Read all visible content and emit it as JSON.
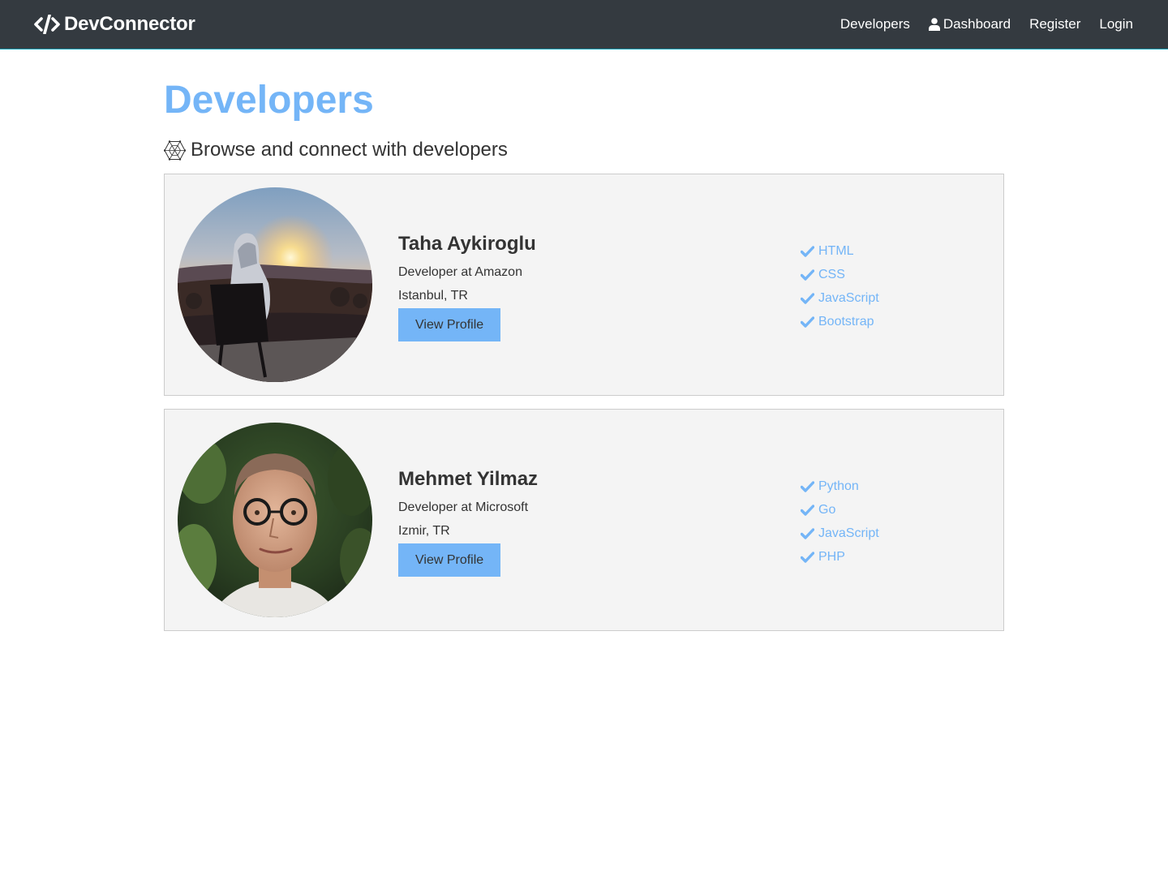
{
  "navbar": {
    "brand": "DevConnector",
    "links": [
      {
        "label": "Developers"
      },
      {
        "label": "Dashboard",
        "icon": "user-icon"
      },
      {
        "label": "Register"
      },
      {
        "label": "Login"
      }
    ]
  },
  "main": {
    "title": "Developers",
    "lead": "Browse and connect with developers",
    "lead_icon": "connectdevelop-icon"
  },
  "profiles": [
    {
      "name": "Taha Aykiroglu",
      "status": "Developer at Amazon",
      "location": "Istanbul, TR",
      "button": "View Profile",
      "avatar": "sunset-photo",
      "skills": [
        "HTML",
        "CSS",
        "JavaScript",
        "Bootstrap"
      ]
    },
    {
      "name": "Mehmet Yilmaz",
      "status": "Developer at Microsoft",
      "location": "Izmir, TR",
      "button": "View Profile",
      "avatar": "portrait-photo",
      "skills": [
        "Python",
        "Go",
        "JavaScript",
        "PHP"
      ]
    }
  ],
  "colors": {
    "navbar": "#343a40",
    "primary": "#74b5f7",
    "card": "#f4f4f4",
    "text": "#333333"
  }
}
